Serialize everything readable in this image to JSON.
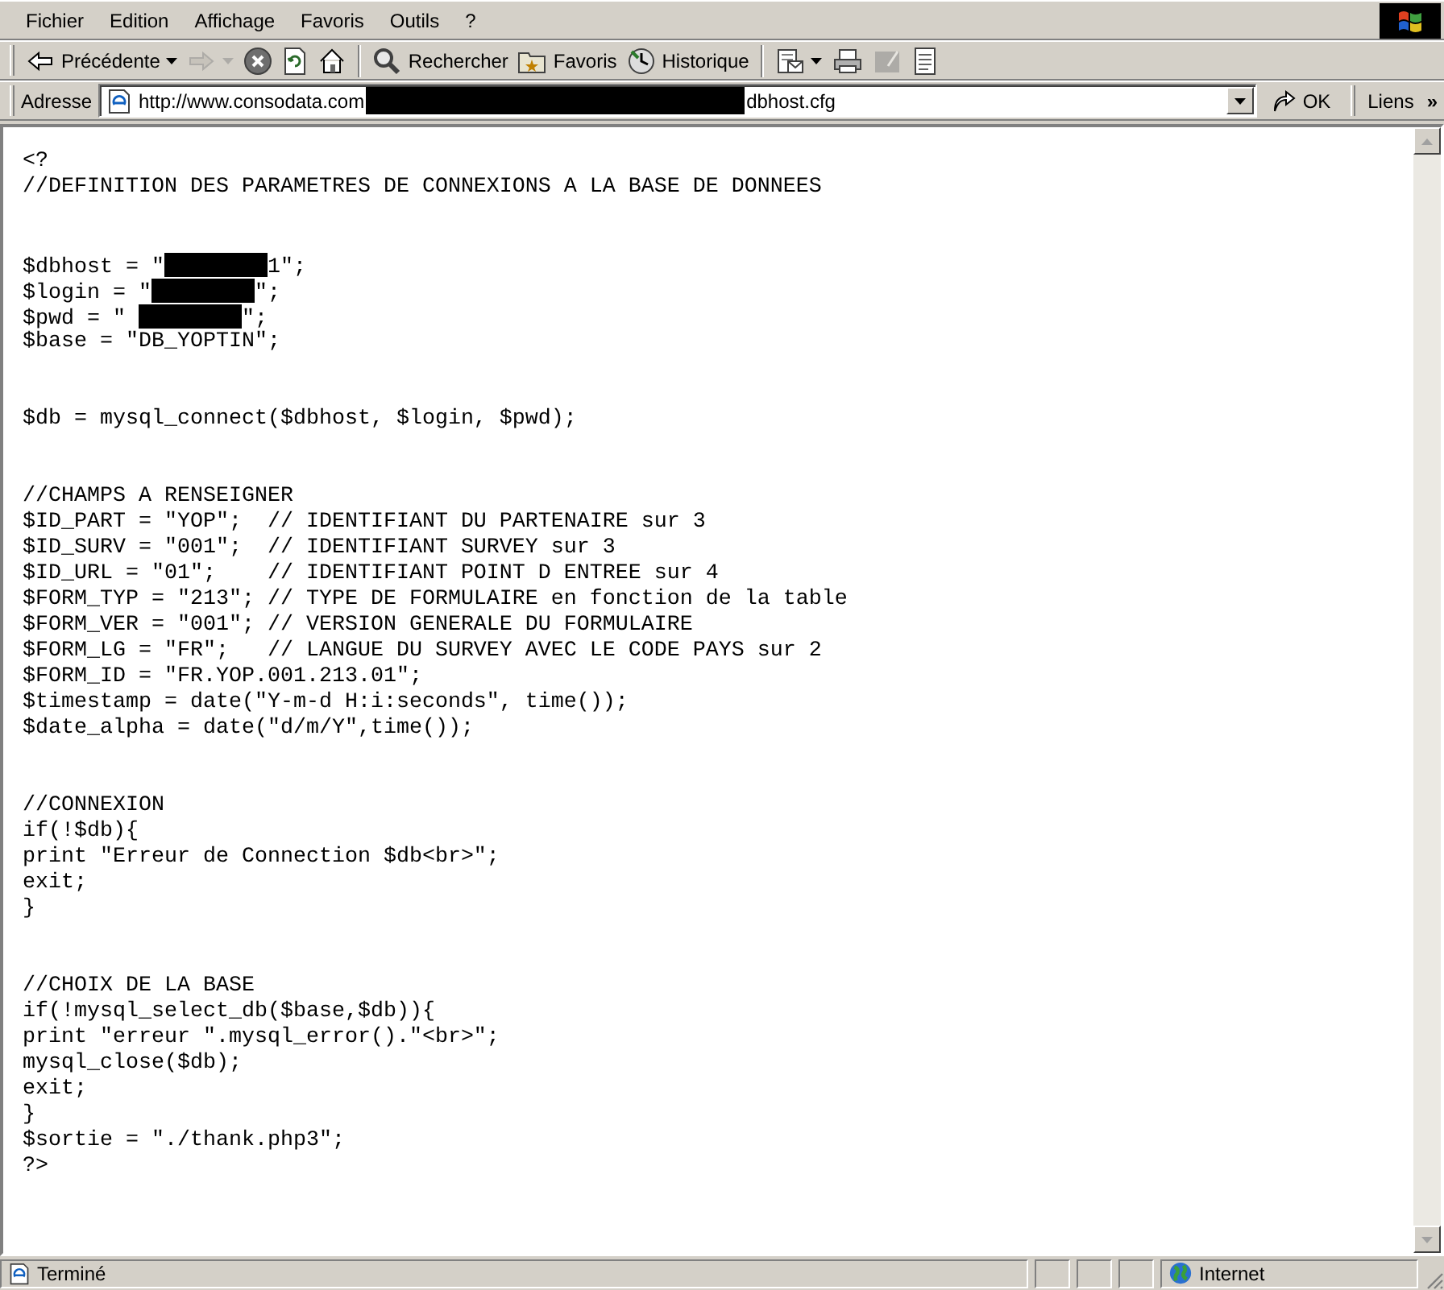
{
  "menu": [
    {
      "label": "Fichier"
    },
    {
      "label": "Edition"
    },
    {
      "label": "Affichage"
    },
    {
      "label": "Favoris"
    },
    {
      "label": "Outils"
    },
    {
      "label": "?"
    }
  ],
  "toolbar": [
    {
      "kind": "back",
      "label": "Précédente",
      "dropdown": true,
      "disabled": false
    },
    {
      "kind": "forward",
      "dropdown": true,
      "disabled": true
    },
    {
      "kind": "stop",
      "dropdown": false,
      "disabled": false
    },
    {
      "kind": "refresh",
      "dropdown": false,
      "disabled": false
    },
    {
      "kind": "home",
      "dropdown": false,
      "disabled": false
    },
    {
      "kind": "separator"
    },
    {
      "kind": "search",
      "label": "Rechercher",
      "dropdown": false,
      "disabled": false
    },
    {
      "kind": "favorites",
      "label": "Favoris",
      "dropdown": false,
      "disabled": false
    },
    {
      "kind": "history",
      "label": "Historique",
      "dropdown": false,
      "disabled": false
    },
    {
      "kind": "separator"
    },
    {
      "kind": "mail",
      "dropdown": true,
      "disabled": false
    },
    {
      "kind": "print",
      "dropdown": false,
      "disabled": false
    },
    {
      "kind": "edit",
      "dropdown": false,
      "disabled": true
    },
    {
      "kind": "discuss",
      "dropdown": false,
      "disabled": false
    }
  ],
  "address": {
    "label": "Adresse",
    "url_before": "http://www.consodata.com",
    "url_masked": true,
    "url_after": "dbhost.cfg",
    "go": "OK",
    "links": "Liens",
    "links_more": "»"
  },
  "code_lines": [
    {
      "kind": "text",
      "text": "<?"
    },
    {
      "kind": "text",
      "text": "//DEFINITION DES PARAMETRES DE CONNEXIONS A LA BASE DE DONNEES"
    },
    {
      "kind": "blank"
    },
    {
      "kind": "blank"
    },
    {
      "kind": "masked",
      "before": "$dbhost = \"",
      "after": "1\";"
    },
    {
      "kind": "masked",
      "before": "$login = \"",
      "after": "\";"
    },
    {
      "kind": "masked",
      "before": "$pwd = \" ",
      "after": "\";"
    },
    {
      "kind": "text",
      "text": "$base = \"DB_YOPTIN\";"
    },
    {
      "kind": "blank"
    },
    {
      "kind": "blank"
    },
    {
      "kind": "text",
      "text": "$db = mysql_connect($dbhost, $login, $pwd);"
    },
    {
      "kind": "blank"
    },
    {
      "kind": "blank"
    },
    {
      "kind": "text",
      "text": "//CHAMPS A RENSEIGNER"
    },
    {
      "kind": "text",
      "text": "$ID_PART = \"YOP\";  // IDENTIFIANT DU PARTENAIRE sur 3"
    },
    {
      "kind": "text",
      "text": "$ID_SURV = \"001\";  // IDENTIFIANT SURVEY sur 3"
    },
    {
      "kind": "text",
      "text": "$ID_URL = \"01\";    // IDENTIFIANT POINT D ENTREE sur 4"
    },
    {
      "kind": "text",
      "text": "$FORM_TYP = \"213\"; // TYPE DE FORMULAIRE en fonction de la table"
    },
    {
      "kind": "text",
      "text": "$FORM_VER = \"001\"; // VERSION GENERALE DU FORMULAIRE"
    },
    {
      "kind": "text",
      "text": "$FORM_LG = \"FR\";   // LANGUE DU SURVEY AVEC LE CODE PAYS sur 2"
    },
    {
      "kind": "text",
      "text": "$FORM_ID = \"FR.YOP.001.213.01\";"
    },
    {
      "kind": "text",
      "text": "$timestamp = date(\"Y-m-d H:i:seconds\", time());"
    },
    {
      "kind": "text",
      "text": "$date_alpha = date(\"d/m/Y\",time());"
    },
    {
      "kind": "blank"
    },
    {
      "kind": "blank"
    },
    {
      "kind": "text",
      "text": "//CONNEXION"
    },
    {
      "kind": "text",
      "text": "if(!$db){"
    },
    {
      "kind": "text",
      "text": "print \"Erreur de Connection $db<br>\";"
    },
    {
      "kind": "text",
      "text": "exit;"
    },
    {
      "kind": "text",
      "text": "}"
    },
    {
      "kind": "blank"
    },
    {
      "kind": "blank"
    },
    {
      "kind": "text",
      "text": "//CHOIX DE LA BASE"
    },
    {
      "kind": "text",
      "text": "if(!mysql_select_db($base,$db)){"
    },
    {
      "kind": "text",
      "text": "print \"erreur \".mysql_error().\"<br>\";"
    },
    {
      "kind": "text",
      "text": "mysql_close($db);"
    },
    {
      "kind": "text",
      "text": "exit;"
    },
    {
      "kind": "text",
      "text": "}"
    },
    {
      "kind": "text",
      "text": "$sortie = \"./thank.php3\";"
    },
    {
      "kind": "text",
      "text": "?>"
    }
  ],
  "status_bar": {
    "text": "Terminé",
    "zone": "Internet"
  }
}
